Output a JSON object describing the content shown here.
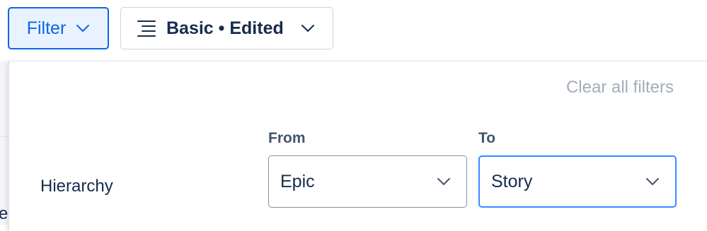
{
  "toolbar": {
    "filter_label": "Filter",
    "view_label": "Basic • Edited"
  },
  "panel": {
    "clear_label": "Clear all filters",
    "hierarchy": {
      "row_label": "Hierarchy",
      "from_label": "From",
      "from_value": "Epic",
      "to_label": "To",
      "to_value": "Story"
    }
  },
  "page": {
    "partial_text": "e"
  },
  "colors": {
    "accent": "#0c66e4",
    "accent_bg": "#e9f2ff",
    "focus_border": "#388bff",
    "muted_text": "#a5adba"
  }
}
